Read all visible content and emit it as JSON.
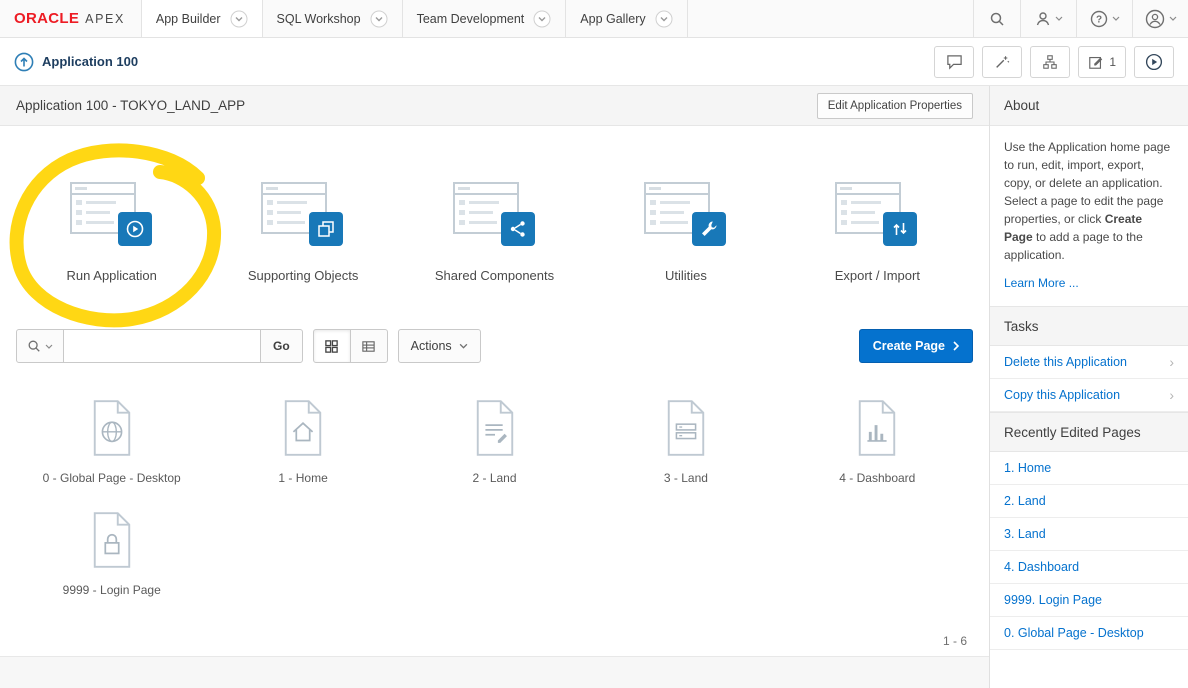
{
  "header": {
    "logo_primary": "ORACLE",
    "logo_secondary": "APEX",
    "tabs": [
      {
        "label": "App Builder"
      },
      {
        "label": "SQL Workshop"
      },
      {
        "label": "Team Development"
      },
      {
        "label": "App Gallery"
      }
    ]
  },
  "breadcrumb": {
    "title": "Application 100",
    "edit_count": "1"
  },
  "main": {
    "title": "Application 100 - TOKYO_LAND_APP",
    "edit_properties_label": "Edit Application Properties",
    "sections": [
      {
        "label": "Run Application",
        "icon": "run-application-icon"
      },
      {
        "label": "Supporting Objects",
        "icon": "supporting-objects-icon"
      },
      {
        "label": "Shared Components",
        "icon": "shared-components-icon"
      },
      {
        "label": "Utilities",
        "icon": "utilities-icon"
      },
      {
        "label": "Export / Import",
        "icon": "export-import-icon"
      }
    ],
    "toolbar": {
      "search_value": "",
      "go_label": "Go",
      "actions_label": "Actions",
      "create_page_label": "Create Page"
    },
    "pages": [
      {
        "label": "0 - Global Page - Desktop",
        "icon": "globe-page-icon"
      },
      {
        "label": "1 - Home",
        "icon": "home-page-icon"
      },
      {
        "label": "2 - Land",
        "icon": "form-page-icon"
      },
      {
        "label": "3 - Land",
        "icon": "report-page-icon"
      },
      {
        "label": "4 - Dashboard",
        "icon": "chart-page-icon"
      },
      {
        "label": "9999 - Login Page",
        "icon": "lock-page-icon"
      }
    ],
    "pagination": "1 - 6"
  },
  "sidebar": {
    "about": {
      "title": "About",
      "text_1": "Use the Application home page to run, edit, import, export, copy, or delete an application. Select a page to edit the page properties, or click ",
      "text_bold": "Create Page",
      "text_2": " to add a page to the application.",
      "learn_more": "Learn More ..."
    },
    "tasks": {
      "title": "Tasks",
      "items": [
        {
          "label": "Delete this Application"
        },
        {
          "label": "Copy this Application"
        }
      ]
    },
    "recent": {
      "title": "Recently Edited Pages",
      "items": [
        {
          "label": "1. Home"
        },
        {
          "label": "2. Land"
        },
        {
          "label": "3. Land"
        },
        {
          "label": "4. Dashboard"
        },
        {
          "label": "9999. Login Page"
        },
        {
          "label": "0. Global Page - Desktop"
        }
      ]
    }
  },
  "colors": {
    "link_blue": "#0572ce",
    "badge_blue": "#1878b8",
    "highlight_yellow": "#ffd400",
    "oracle_red": "#ed1c24"
  }
}
